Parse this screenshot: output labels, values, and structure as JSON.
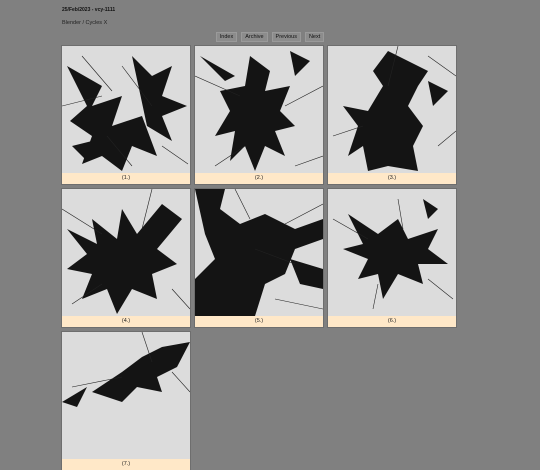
{
  "header": {
    "title": "25/Feb/2023 - vcy-1111",
    "subtitle": "Blender / Cycles X"
  },
  "nav": {
    "index": "Index",
    "archive": "Archive",
    "previous": "Previous",
    "next": "Next"
  },
  "gallery": {
    "captions": [
      "(1.)",
      "(2.)",
      "(3.)",
      "(4.)",
      "(5.)",
      "(6.)",
      "(7.)"
    ]
  },
  "colors": {
    "page_bg": "#808080",
    "thumb_bg": "#dcdcdc",
    "caption_bg": "#ffe8c8",
    "ink": "#111111"
  }
}
